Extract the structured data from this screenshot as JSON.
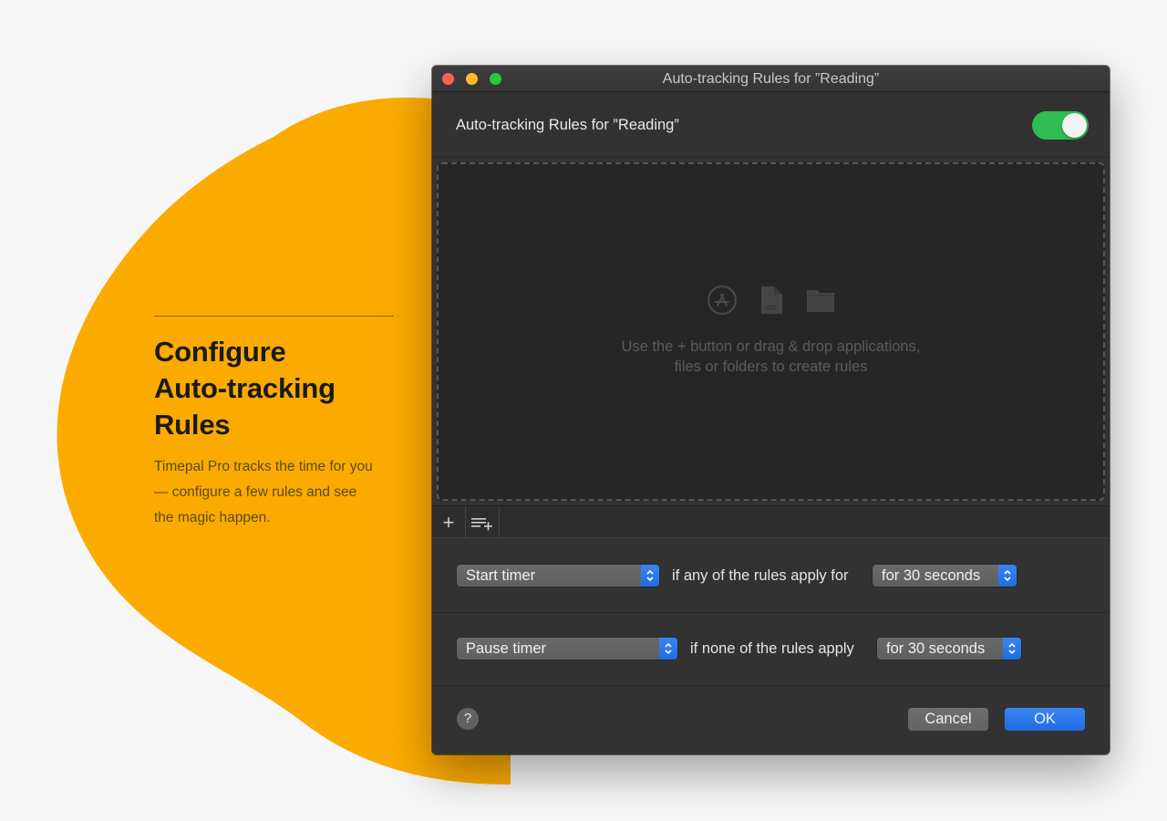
{
  "promo": {
    "title_line1": "Configure",
    "title_line2": "Auto-tracking",
    "title_line3": "Rules",
    "body": "Timepal Pro tracks the time for you — configure a few rules and see the magic happen."
  },
  "window": {
    "title": "Auto-tracking Rules for ”Reading”",
    "header_title": "Auto-tracking Rules for ”Reading”",
    "enabled": true
  },
  "dropzone": {
    "line1": "Use the + button or drag & drop applications,",
    "line2": "files or folders to create rules",
    "icons": [
      "app-store-icon",
      "document-icon",
      "folder-icon"
    ]
  },
  "toolbar": {
    "add_label": "+",
    "icons": [
      "add-icon",
      "add-list-icon"
    ]
  },
  "rules": {
    "start": {
      "action": "Start timer",
      "condition": "if any of the rules apply for",
      "duration": "for 30 seconds"
    },
    "pause": {
      "action": "Pause timer",
      "condition": "if none of the rules apply",
      "duration": "for 30 seconds"
    }
  },
  "footer": {
    "help_label": "?",
    "cancel_label": "Cancel",
    "ok_label": "OK"
  },
  "colors": {
    "accent_orange": "#FBAB00",
    "accent_blue": "#1F6BE0",
    "toggle_green": "#2EBD51"
  }
}
